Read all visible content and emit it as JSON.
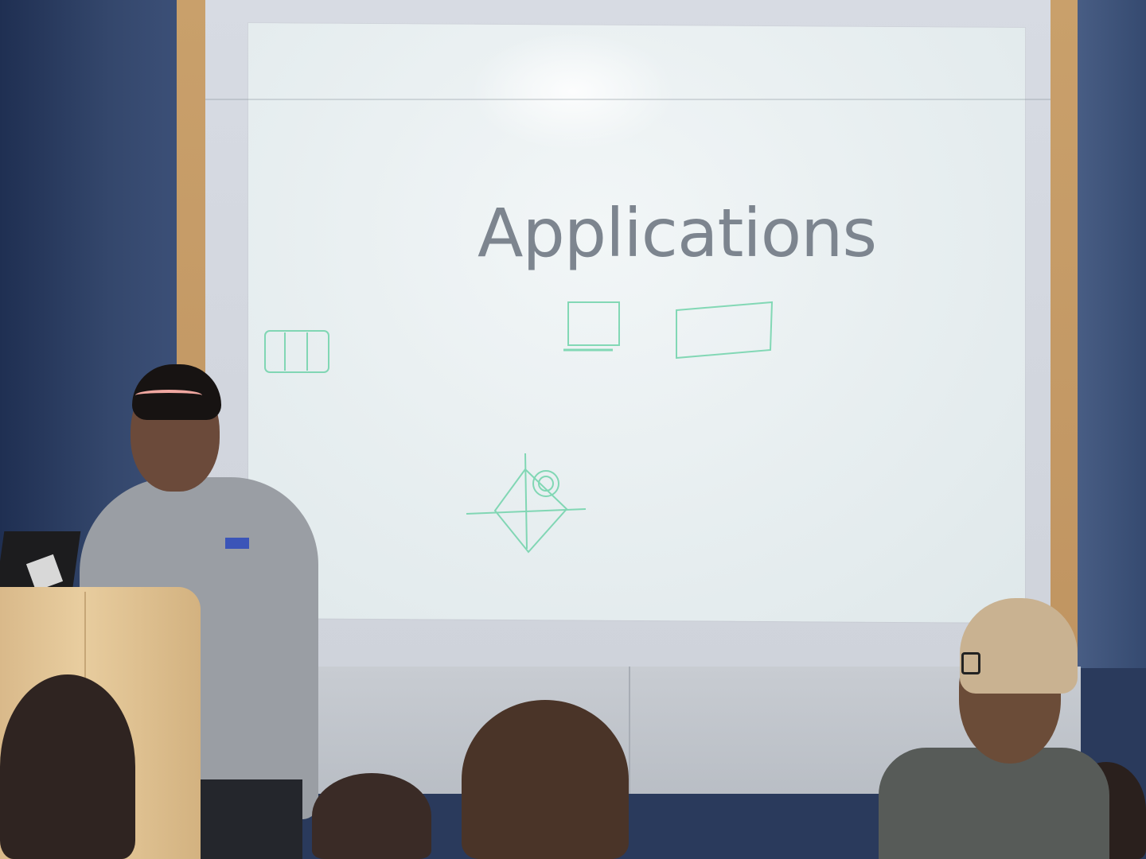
{
  "slide": {
    "title": "Applications"
  },
  "colors": {
    "sketch_ink": "#3fbf8a",
    "title_text": "#7d858f",
    "slide_bg": "#e7eef0",
    "wall_blue": "#34476c",
    "frame_wood": "#c9a06b"
  }
}
